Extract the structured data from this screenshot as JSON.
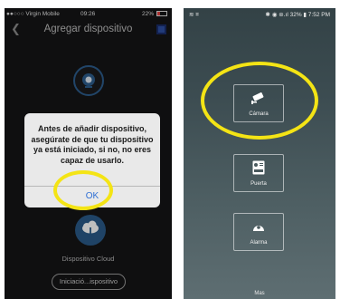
{
  "left_phone": {
    "status": {
      "carrier": "●●○○○ Virgin Mobile",
      "time": "09:26",
      "battery": "22%"
    },
    "nav": {
      "title": "Agregar dispositivo"
    },
    "dialog": {
      "message": "Antes de añadir dispositivo, asegúrate de que tu dispositivo ya está iniciado, si no, no eres capaz de usarlo.",
      "ok_label": "OK"
    },
    "cloud_label": "Dispositivo Cloud",
    "init_button": "Iniciació...ispositivo"
  },
  "right_phone": {
    "status": {
      "left": "≋ ⌗",
      "right": "✱ ◉ ⊜.ıl 32% ▮ 7:52 PM"
    },
    "tiles": [
      {
        "label": "Cámara",
        "icon": "camera-icon"
      },
      {
        "label": "Puerta",
        "icon": "door-intercom-icon"
      },
      {
        "label": "Alarma",
        "icon": "alarm-icon"
      }
    ],
    "more_label": "Mas"
  },
  "colors": {
    "accent_yellow": "#f4e415",
    "ok_blue": "#2f6fd4",
    "cloud_blue": "#2a5a88"
  }
}
